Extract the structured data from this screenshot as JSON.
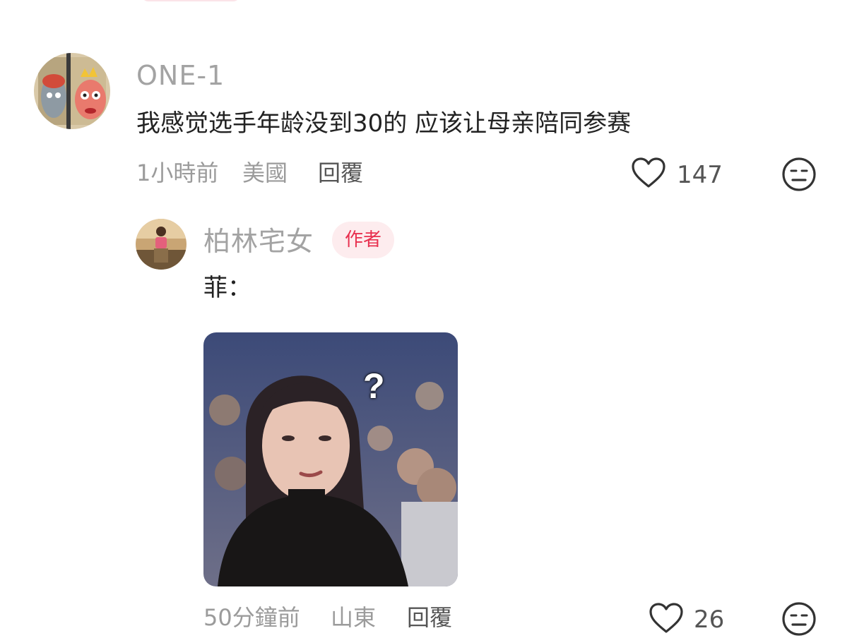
{
  "comments": [
    {
      "username": "ONE-1",
      "text": "我感觉选手年龄没到30的 应该让母亲陪同参赛",
      "time": "1小時前",
      "location": "美國",
      "reply_label": "回覆",
      "likes": "147"
    }
  ],
  "reply": {
    "username": "柏林宅女",
    "badge": "作者",
    "text": "菲：",
    "meme_mark": "?",
    "time": "50分鐘前",
    "location": "山東",
    "reply_label": "回覆",
    "likes": "26"
  },
  "colors": {
    "accent": "#e8304f",
    "badge_bg": "#fdecee",
    "muted_text": "#9b9b9b",
    "body_text": "#222222"
  },
  "icons": [
    "heart-outline-icon",
    "meh-face-icon"
  ]
}
